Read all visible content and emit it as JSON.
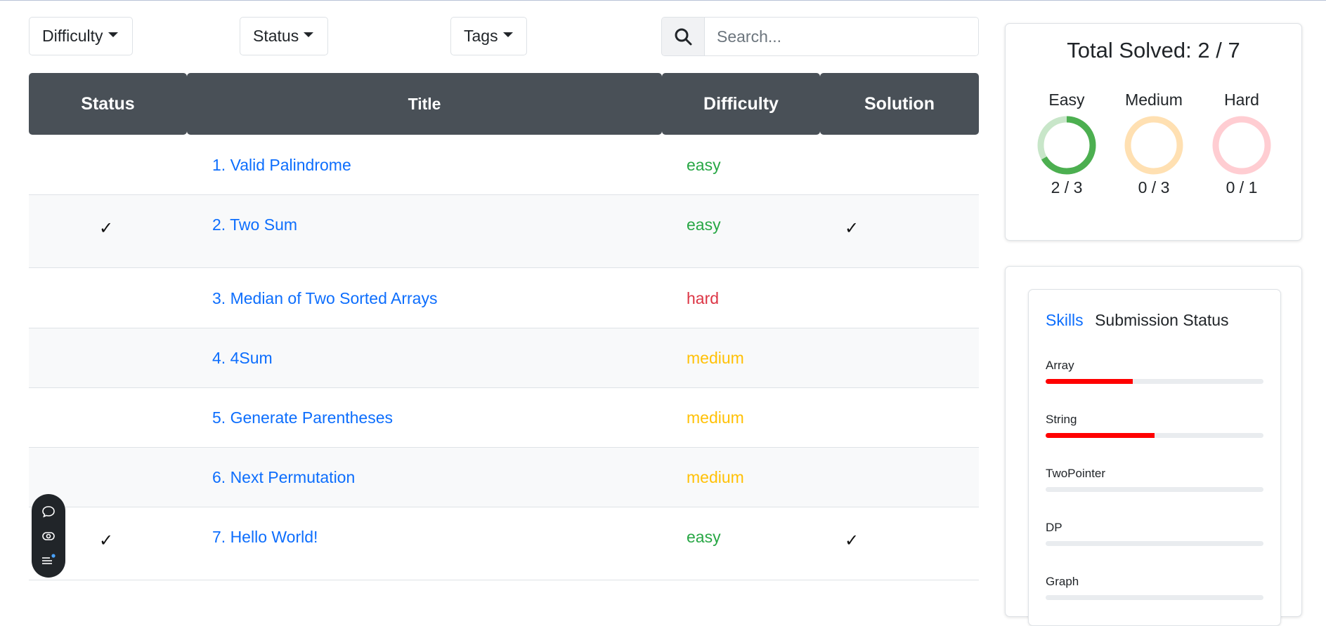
{
  "filters": {
    "difficulty_label": "Difficulty",
    "status_label": "Status",
    "tags_label": "Tags",
    "search_placeholder": "Search..."
  },
  "table": {
    "headers": [
      "Status",
      "Title",
      "Difficulty",
      "Solution"
    ],
    "rows": [
      {
        "title": "1. Valid Palindrome",
        "difficulty": "easy",
        "status_checked": false,
        "solution_checked": false
      },
      {
        "title": "2. Two Sum",
        "difficulty": "easy",
        "status_checked": true,
        "solution_checked": true
      },
      {
        "title": "3. Median of Two Sorted Arrays",
        "difficulty": "hard",
        "status_checked": false,
        "solution_checked": false
      },
      {
        "title": "4. 4Sum",
        "difficulty": "medium",
        "status_checked": false,
        "solution_checked": false
      },
      {
        "title": "5. Generate Parentheses",
        "difficulty": "medium",
        "status_checked": false,
        "solution_checked": false
      },
      {
        "title": "6. Next Permutation",
        "difficulty": "medium",
        "status_checked": false,
        "solution_checked": false
      },
      {
        "title": "7. Hello World!",
        "difficulty": "easy",
        "status_checked": true,
        "solution_checked": true
      }
    ],
    "check_glyph": "✓"
  },
  "summary": {
    "total_label": "Total Solved: 2 / 7",
    "levels": [
      {
        "label": "Easy",
        "count": "2 / 3",
        "solved": 2,
        "total": 3,
        "color": "#4caf50",
        "track_color": "#c8e6c9"
      },
      {
        "label": "Medium",
        "count": "0 / 3",
        "solved": 0,
        "total": 3,
        "color": "#ffb74d",
        "track_color": "#ffe0b2"
      },
      {
        "label": "Hard",
        "count": "0 / 1",
        "solved": 0,
        "total": 1,
        "color": "#ef5350",
        "track_color": "#ffcdd2"
      }
    ]
  },
  "skills_panel": {
    "tab_skills": "Skills",
    "tab_submission": "Submission Status",
    "skills": [
      {
        "name": "Array",
        "progress": 0.4
      },
      {
        "name": "String",
        "progress": 0.5
      },
      {
        "name": "TwoPointer",
        "progress": 0
      },
      {
        "name": "DP",
        "progress": 0
      },
      {
        "name": "Graph",
        "progress": 0
      }
    ]
  },
  "floating_toolbar": {
    "icons": [
      "chat-icon",
      "eye-icon",
      "menu-icon"
    ],
    "badge_color": "#4aa3ff"
  }
}
